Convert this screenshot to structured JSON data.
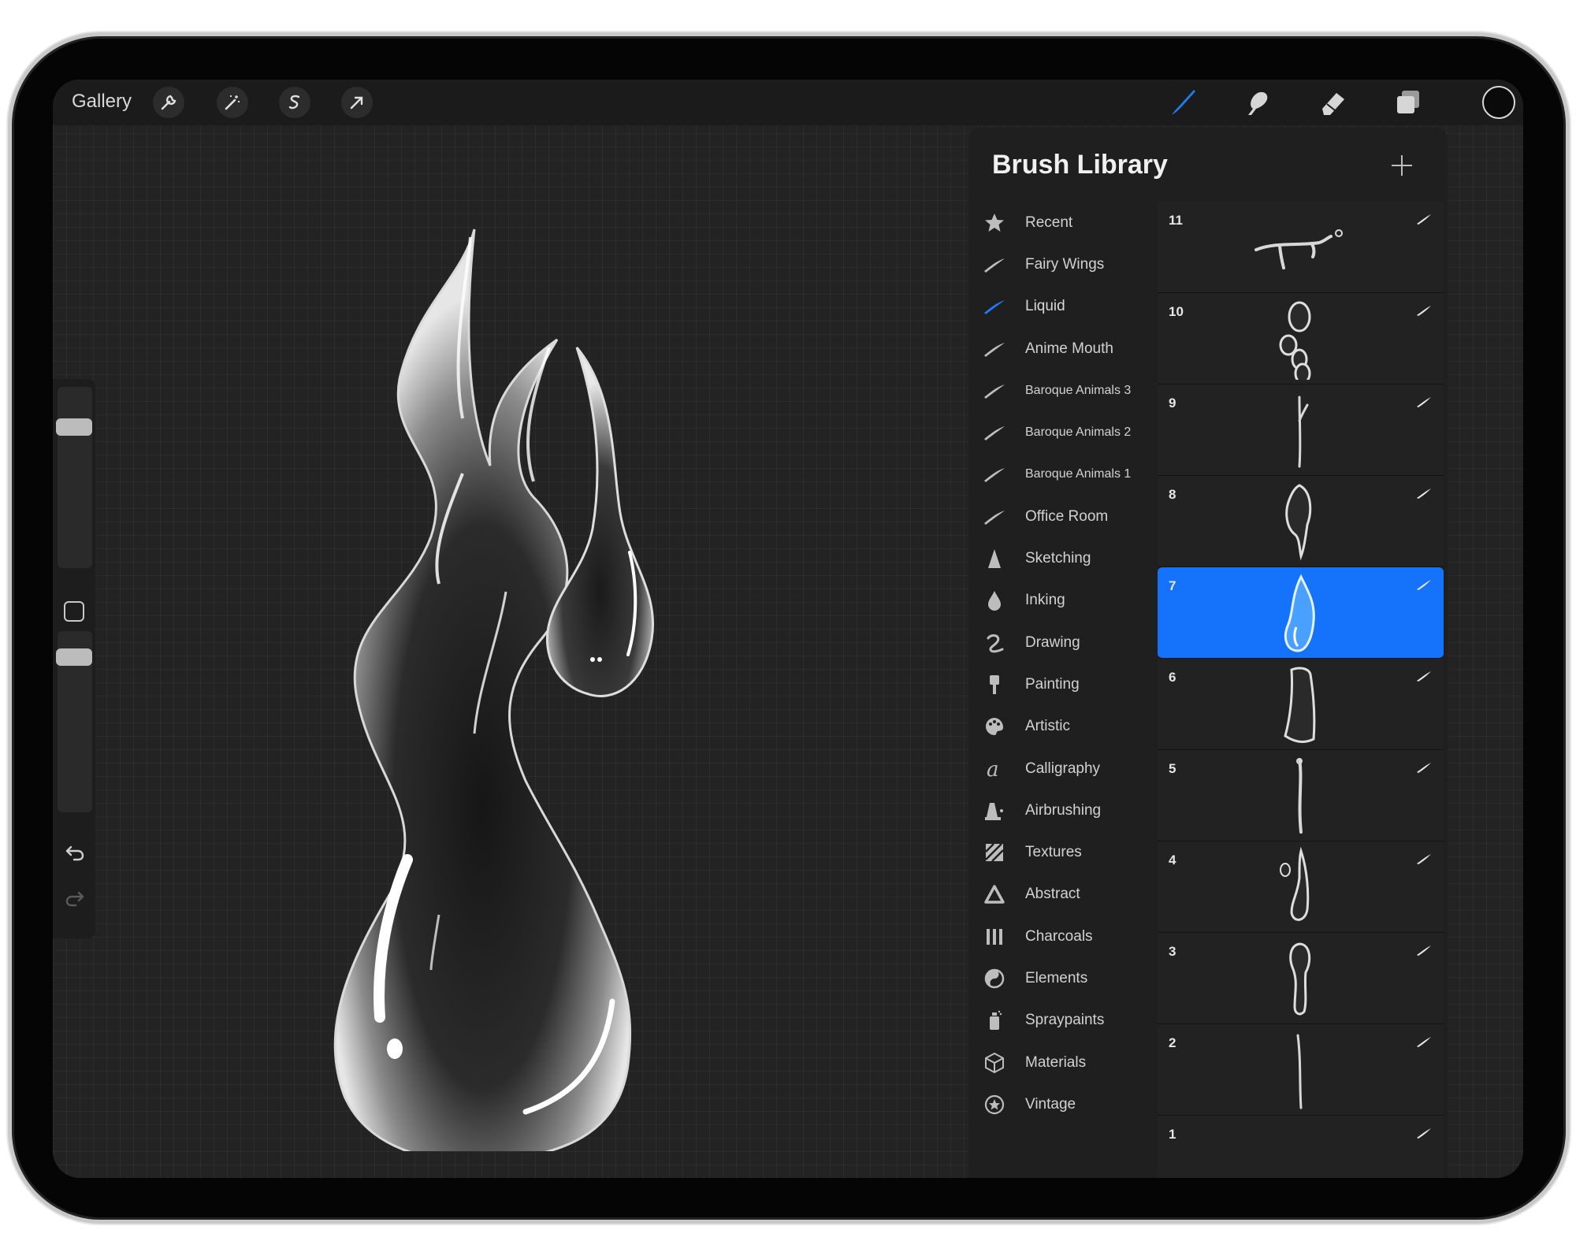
{
  "toolbar": {
    "gallery_label": "Gallery",
    "left_tools": [
      "wrench-icon",
      "magic-wand-icon",
      "selection-icon",
      "transform-arrow-icon"
    ],
    "right_tools": [
      "brush-icon",
      "smudge-icon",
      "eraser-icon",
      "layers-icon"
    ],
    "active_tool": "brush-icon",
    "accent_color": "#1e7cf5",
    "current_color": "#0a0a0a"
  },
  "sidebar": {
    "size_level": 0.95,
    "opacity_level": 0.95
  },
  "brush_library": {
    "title": "Brush Library",
    "add_icon": "plus-icon",
    "selected_set": "Liquid",
    "sets": [
      {
        "label": "Recent",
        "icon": "star-icon"
      },
      {
        "label": "Fairy Wings",
        "icon": "brush-stroke-icon"
      },
      {
        "label": "Liquid",
        "icon": "brush-stroke-icon"
      },
      {
        "label": "Anime Mouth",
        "icon": "brush-stroke-icon"
      },
      {
        "label": "Baroque Animals 3",
        "icon": "brush-stroke-icon"
      },
      {
        "label": "Baroque Animals 2",
        "icon": "brush-stroke-icon"
      },
      {
        "label": "Baroque Animals 1",
        "icon": "brush-stroke-icon"
      },
      {
        "label": "Office Room",
        "icon": "brush-stroke-icon"
      },
      {
        "label": "Sketching",
        "icon": "pencil-tip-icon"
      },
      {
        "label": "Inking",
        "icon": "ink-drop-icon"
      },
      {
        "label": "Drawing",
        "icon": "squiggle-icon"
      },
      {
        "label": "Painting",
        "icon": "paint-brush-icon"
      },
      {
        "label": "Artistic",
        "icon": "palette-icon"
      },
      {
        "label": "Calligraphy",
        "icon": "calligraphy-icon"
      },
      {
        "label": "Airbrushing",
        "icon": "airbrush-icon"
      },
      {
        "label": "Textures",
        "icon": "texture-icon"
      },
      {
        "label": "Abstract",
        "icon": "triangle-icon"
      },
      {
        "label": "Charcoals",
        "icon": "charcoal-icon"
      },
      {
        "label": "Elements",
        "icon": "yin-yang-icon"
      },
      {
        "label": "Spraypaints",
        "icon": "spray-can-icon"
      },
      {
        "label": "Materials",
        "icon": "cube-icon"
      },
      {
        "label": "Vintage",
        "icon": "badge-star-icon"
      }
    ],
    "brushes": [
      {
        "number": "11"
      },
      {
        "number": "10"
      },
      {
        "number": "9"
      },
      {
        "number": "8"
      },
      {
        "number": "7"
      },
      {
        "number": "6"
      },
      {
        "number": "5"
      },
      {
        "number": "4"
      },
      {
        "number": "3"
      },
      {
        "number": "2"
      },
      {
        "number": "1"
      }
    ],
    "selected_brush": "7"
  }
}
